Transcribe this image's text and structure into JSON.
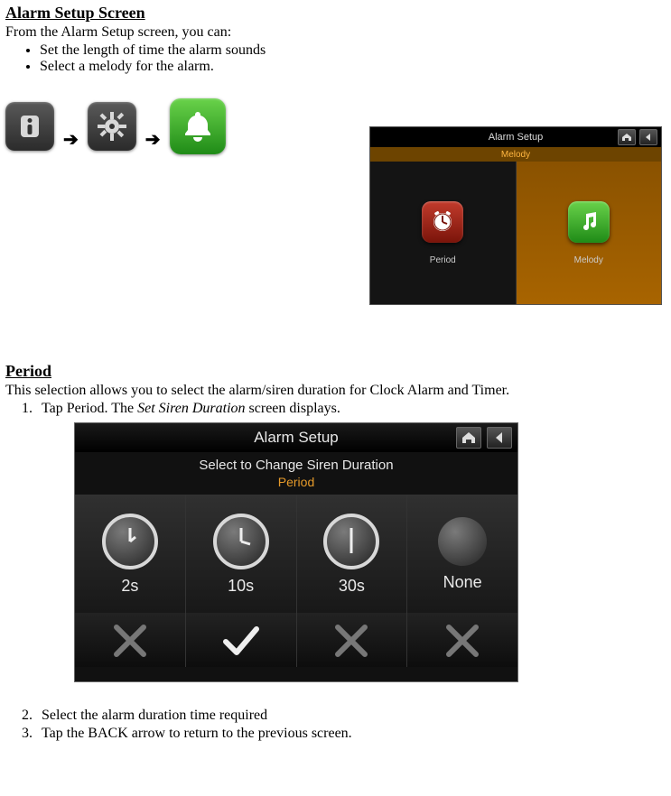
{
  "section1": {
    "title": "Alarm Setup Screen",
    "intro": "From the Alarm Setup screen, you can:",
    "bullets": [
      "Set the length of time the alarm sounds",
      "Select a melody for the alarm."
    ]
  },
  "navIcons": {
    "info": "info-icon",
    "gear": "gear-icon",
    "bell": "bell-icon",
    "arrow": "➔"
  },
  "screenshot1": {
    "title": "Alarm Setup",
    "subbar": "Melody",
    "leftLabel": "Period",
    "rightLabel": "Melody"
  },
  "section2": {
    "title": "Period",
    "desc": "This selection allows you to select the alarm/siren duration for Clock Alarm and Timer.",
    "step1_a": "Tap Period. The ",
    "step1_b": "Set Siren Duration",
    "step1_c": " screen displays.",
    "step2": "Select the alarm duration time required",
    "step3": "Tap the BACK arrow to return to the previous screen."
  },
  "screenshot2": {
    "title": "Alarm Setup",
    "sub1": "Select to Change Siren Duration",
    "sub2": "Period",
    "options": [
      "2s",
      "10s",
      "30s",
      "None"
    ],
    "selectedIndex": 1
  }
}
